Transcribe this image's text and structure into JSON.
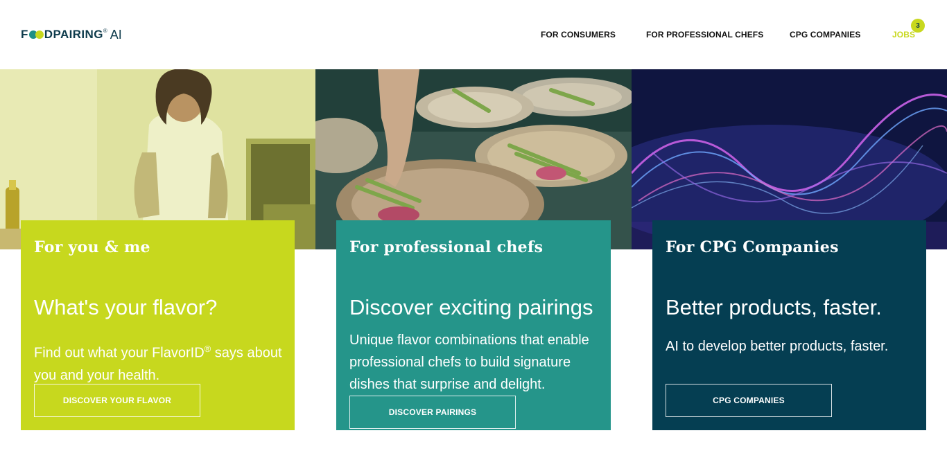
{
  "brand": {
    "logo_prefix": "F",
    "logo_suffix": "DPAIRING",
    "logo_ai": "AI",
    "logo_reg": "®",
    "colors": {
      "navy": "#0e3b4c",
      "lime": "#c7d81e",
      "teal": "#25958a",
      "petrol": "#053e52"
    }
  },
  "nav": {
    "items": [
      {
        "label": "FOR CONSUMERS"
      },
      {
        "label": "FOR PROFESSIONAL CHEFS"
      },
      {
        "label": "CPG COMPANIES"
      },
      {
        "label": "JOBS",
        "badge": "3"
      }
    ]
  },
  "photos": [
    {
      "subject": "woman cooking in kitchen"
    },
    {
      "subject": "chef plating asparagus dishes"
    },
    {
      "subject": "abstract glowing light waves"
    }
  ],
  "cards": [
    {
      "kicker": "For you & me",
      "title": "What's your flavor?",
      "desc_before": "Find out what your FlavorID",
      "desc_sup": "®",
      "desc_after": " says about you and your health.",
      "button": "DISCOVER YOUR FLAVOR"
    },
    {
      "kicker": "For professional chefs",
      "title": "Discover exciting pairings",
      "desc": "Unique flavor combinations that enable professional chefs to build signature dishes that surprise and delight.",
      "button": "DISCOVER PAIRINGS"
    },
    {
      "kicker": "For CPG Companies",
      "title": "Better products, faster.",
      "desc": "AI to develop better products, faster.",
      "button": "CPG COMPANIES"
    }
  ]
}
